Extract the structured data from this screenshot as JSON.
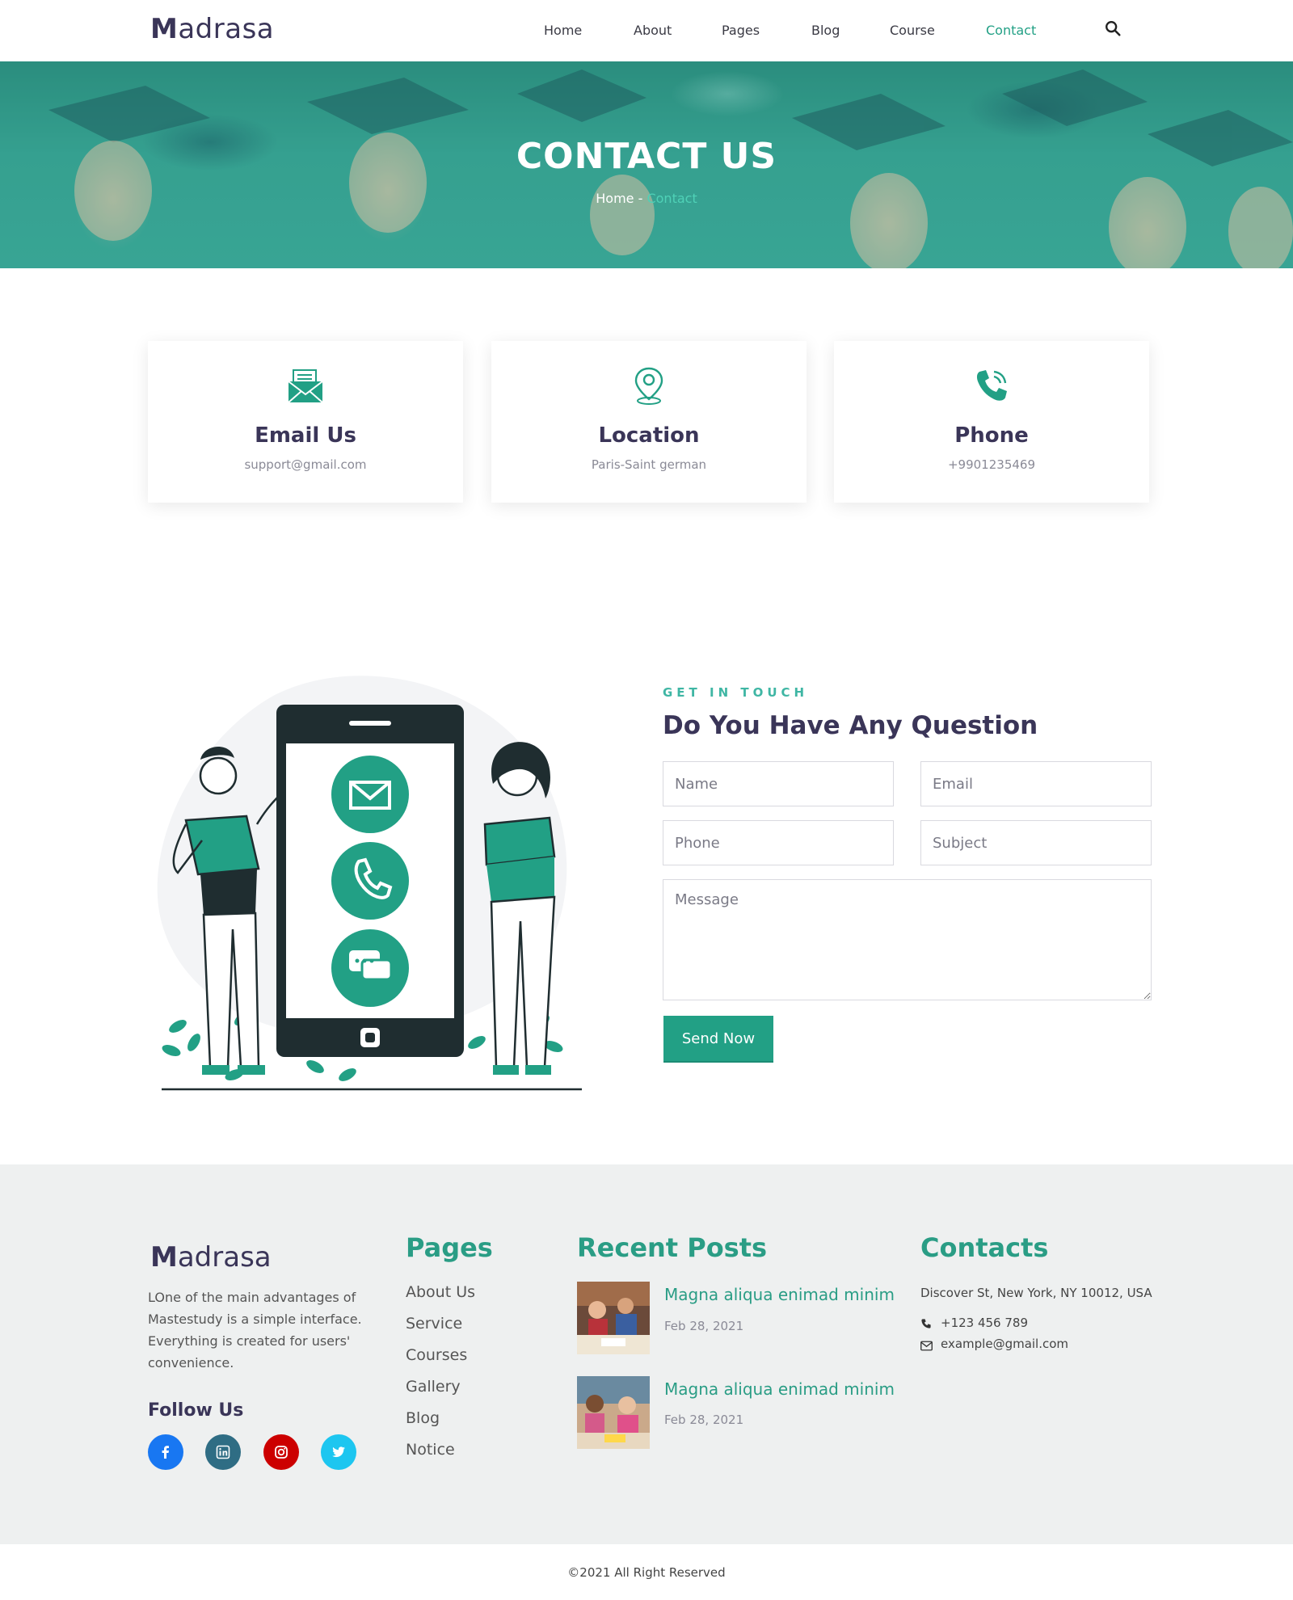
{
  "header": {
    "logo_initial": "M",
    "logo_rest": "adrasa",
    "nav": [
      {
        "label": "Home",
        "active": false
      },
      {
        "label": "About",
        "active": false
      },
      {
        "label": "Pages",
        "active": false
      },
      {
        "label": "Blog",
        "active": false
      },
      {
        "label": "Course",
        "active": false
      },
      {
        "label": "Contact",
        "active": true
      }
    ],
    "search_icon": "search-icon"
  },
  "hero": {
    "title": "CONTACT US",
    "breadcrumb_home": "Home",
    "breadcrumb_sep": " - ",
    "breadcrumb_current": "Contact"
  },
  "info_cards": [
    {
      "icon": "envelope-icon",
      "title": "Email Us",
      "value": "support@gmail.com"
    },
    {
      "icon": "location-pin-icon",
      "title": "Location",
      "value": "Paris-Saint german"
    },
    {
      "icon": "phone-icon",
      "title": "Phone",
      "value": "+9901235469"
    }
  ],
  "contact_form": {
    "eyebrow": "GET IN TOUCH",
    "heading": "Do You Have Any Question",
    "name_placeholder": "Name",
    "email_placeholder": "Email",
    "phone_placeholder": "Phone",
    "subject_placeholder": "Subject",
    "message_placeholder": "Message",
    "submit_label": "Send Now"
  },
  "footer": {
    "logo_initial": "M",
    "logo_rest": "adrasa",
    "about": "LOne of the main advantages of Mastestudy is a simple interface. Everything is created for users' convenience.",
    "follow_heading": "Follow Us",
    "social": [
      {
        "icon": "facebook-icon",
        "color": "#1877f2"
      },
      {
        "icon": "linkedin-icon",
        "color": "#2f6d84"
      },
      {
        "icon": "instagram-icon",
        "color": "#cc0000"
      },
      {
        "icon": "twitter-icon",
        "color": "#1dc6f0"
      }
    ],
    "pages_heading": "Pages",
    "pages": [
      "About Us",
      "Service",
      "Courses",
      "Gallery",
      "Blog",
      "Notice"
    ],
    "posts_heading": "Recent Posts",
    "posts": [
      {
        "title": "Magna aliqua enimad minim",
        "date": "Feb 28, 2021"
      },
      {
        "title": "Magna aliqua enimad minim",
        "date": "Feb 28, 2021"
      }
    ],
    "contacts_heading": "Contacts",
    "address": "Discover St, New York, NY 10012, USA",
    "phone": "+123 456 789",
    "email": "example@gmail.com",
    "copyright": "©2021 All Right Reserved"
  },
  "colors": {
    "accent": "#22a085",
    "heading": "#3a3558",
    "footer_bg": "#eef0f0"
  }
}
